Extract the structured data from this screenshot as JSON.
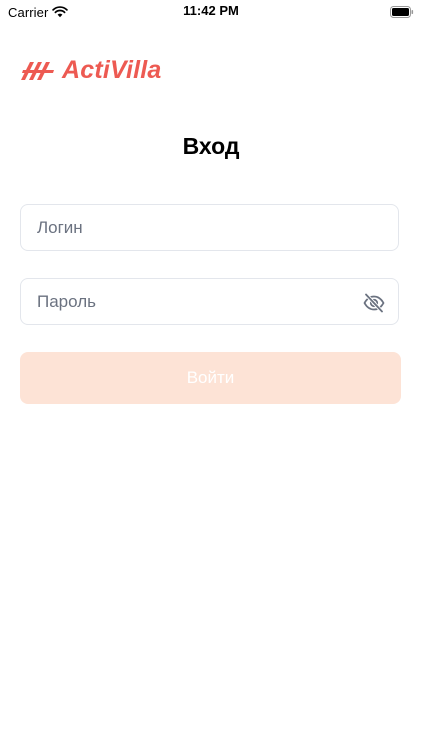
{
  "status_bar": {
    "carrier": "Carrier",
    "time": "11:42 PM",
    "wifi_icon": "wifi-icon",
    "battery_icon": "battery-icon"
  },
  "logo": {
    "text": "ActiVilla",
    "color": "#ed5a52",
    "icon": "activilla-logo-mark"
  },
  "page": {
    "title": "Вход"
  },
  "form": {
    "login_placeholder": "Логин",
    "login_value": "",
    "password_placeholder": "Пароль",
    "password_value": "",
    "visibility_icon": "eye-off-icon",
    "submit_label": "Войти",
    "submit_color": "#fde3d6"
  }
}
